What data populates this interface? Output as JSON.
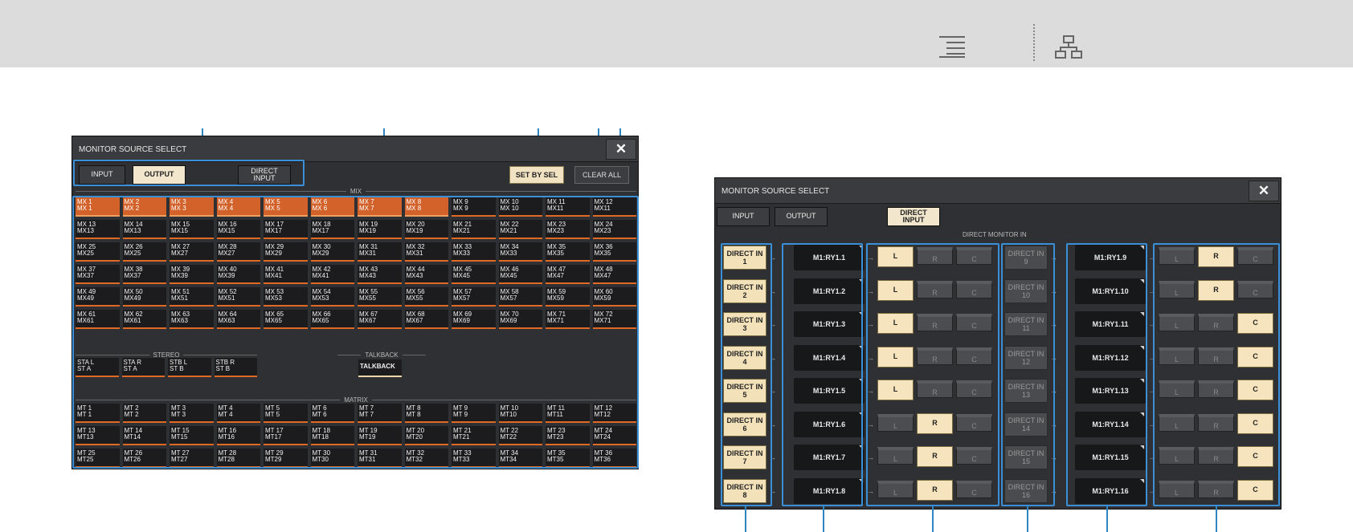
{
  "toolbar": {
    "icons": [
      "list-icon",
      "hierarchy-icon"
    ]
  },
  "left": {
    "title": "MONITOR SOURCE SELECT",
    "close": "✕",
    "tabs": [
      "INPUT",
      "OUTPUT",
      "DIRECT\nINPUT"
    ],
    "set_by_sel": "SET BY SEL",
    "clear_all": "CLEAR ALL",
    "mix_label": "MIX",
    "mix_cells": [
      "MX 1\nMX 1",
      "MX 2\nMX 2",
      "MX 3\nMX 3",
      "MX 4\nMX 4",
      "MX 5\nMX 5",
      "MX 6\nMX 6",
      "MX 7\nMX 7",
      "MX 8\nMX 8",
      "MX 9\nMX 9",
      "MX 10\nMX 10",
      "MX 11\nMX11",
      "MX 12\nMX11",
      "MX 13\nMX13",
      "MX 14\nMX13",
      "MX 15\nMX15",
      "MX 16\nMX15",
      "MX 17\nMX17",
      "MX 18\nMX17",
      "MX 19\nMX19",
      "MX 20\nMX19",
      "MX 21\nMX21",
      "MX 22\nMX21",
      "MX 23\nMX23",
      "MX 24\nMX23",
      "MX 25\nMX25",
      "MX 26\nMX25",
      "MX 27\nMX27",
      "MX 28\nMX27",
      "MX 29\nMX29",
      "MX 30\nMX29",
      "MX 31\nMX31",
      "MX 32\nMX31",
      "MX 33\nMX33",
      "MX 34\nMX33",
      "MX 35\nMX35",
      "MX 36\nMX35",
      "MX 37\nMX37",
      "MX 38\nMX37",
      "MX 39\nMX39",
      "MX 40\nMX39",
      "MX 41\nMX41",
      "MX 42\nMX41",
      "MX 43\nMX43",
      "MX 44\nMX43",
      "MX 45\nMX45",
      "MX 46\nMX45",
      "MX 47\nMX47",
      "MX 48\nMX47",
      "MX 49\nMX49",
      "MX 50\nMX49",
      "MX 51\nMX51",
      "MX 52\nMX51",
      "MX 53\nMX53",
      "MX 54\nMX53",
      "MX 55\nMX55",
      "MX 56\nMX55",
      "MX 57\nMX57",
      "MX 58\nMX57",
      "MX 59\nMX59",
      "MX 60\nMX59",
      "MX 61\nMX61",
      "MX 62\nMX61",
      "MX 63\nMX63",
      "MX 64\nMX63",
      "MX 65\nMX65",
      "MX 66\nMX65",
      "MX 67\nMX67",
      "MX 68\nMX67",
      "MX 69\nMX69",
      "MX 70\nMX69",
      "MX 71\nMX71",
      "MX 72\nMX71"
    ],
    "mix_selected": [
      0,
      1,
      2,
      3,
      4,
      5,
      6,
      7
    ],
    "stereo_label": "STEREO",
    "stereo_cells": [
      "STA L\nST A",
      "STA R\nST A",
      "STB L\nST B",
      "STB R\nST B"
    ],
    "talkback_label": "TALKBACK",
    "talkback_cell": "TALKBACK",
    "matrix_label": "MATRIX",
    "matrix_cells": [
      "MT 1\nMT 1",
      "MT 2\nMT 2",
      "MT 3\nMT 3",
      "MT 4\nMT 4",
      "MT 5\nMT 5",
      "MT 6\nMT 6",
      "MT 7\nMT 7",
      "MT 8\nMT 8",
      "MT 9\nMT 9",
      "MT 10\nMT10",
      "MT 11\nMT11",
      "MT 12\nMT12",
      "MT 13\nMT13",
      "MT 14\nMT14",
      "MT 15\nMT15",
      "MT 16\nMT16",
      "MT 17\nMT17",
      "MT 18\nMT18",
      "MT 19\nMT19",
      "MT 20\nMT20",
      "MT 21\nMT21",
      "MT 22\nMT22",
      "MT 23\nMT23",
      "MT 24\nMT24",
      "MT 25\nMT25",
      "MT 26\nMT26",
      "MT 27\nMT27",
      "MT 28\nMT28",
      "MT 29\nMT29",
      "MT 30\nMT30",
      "MT 31\nMT31",
      "MT 32\nMT32",
      "MT 33\nMT33",
      "MT 34\nMT34",
      "MT 35\nMT35",
      "MT 36\nMT36"
    ]
  },
  "right": {
    "title": "MONITOR SOURCE SELECT",
    "close": "✕",
    "tabs": [
      "INPUT",
      "OUTPUT",
      "DIRECT\nINPUT"
    ],
    "section_label": "DIRECT MONITOR IN",
    "rows_left": [
      {
        "btn": "DIRECT IN\n1",
        "port": "M1:RY1.1",
        "sel": "L"
      },
      {
        "btn": "DIRECT IN\n2",
        "port": "M1:RY1.2",
        "sel": "L"
      },
      {
        "btn": "DIRECT IN\n3",
        "port": "M1:RY1.3",
        "sel": "L"
      },
      {
        "btn": "DIRECT IN\n4",
        "port": "M1:RY1.4",
        "sel": "L"
      },
      {
        "btn": "DIRECT IN\n5",
        "port": "M1:RY1.5",
        "sel": "L"
      },
      {
        "btn": "DIRECT IN\n6",
        "port": "M1:RY1.6",
        "sel": "R"
      },
      {
        "btn": "DIRECT IN\n7",
        "port": "M1:RY1.7",
        "sel": "R"
      },
      {
        "btn": "DIRECT IN\n8",
        "port": "M1:RY1.8",
        "sel": "R"
      }
    ],
    "rows_right": [
      {
        "btn": "DIRECT IN\n9",
        "port": "M1:RY1.9",
        "sel": "R"
      },
      {
        "btn": "DIRECT IN\n10",
        "port": "M1:RY1.10",
        "sel": "R"
      },
      {
        "btn": "DIRECT IN\n11",
        "port": "M1:RY1.11",
        "sel": "C"
      },
      {
        "btn": "DIRECT IN\n12",
        "port": "M1:RY1.12",
        "sel": "C"
      },
      {
        "btn": "DIRECT IN\n13",
        "port": "M1:RY1.13",
        "sel": "C"
      },
      {
        "btn": "DIRECT IN\n14",
        "port": "M1:RY1.14",
        "sel": "C"
      },
      {
        "btn": "DIRECT IN\n15",
        "port": "M1:RY1.15",
        "sel": "C"
      },
      {
        "btn": "DIRECT IN\n16",
        "port": "M1:RY1.16",
        "sel": "C"
      }
    ],
    "lrc_labels": [
      "L",
      "R",
      "C"
    ]
  }
}
